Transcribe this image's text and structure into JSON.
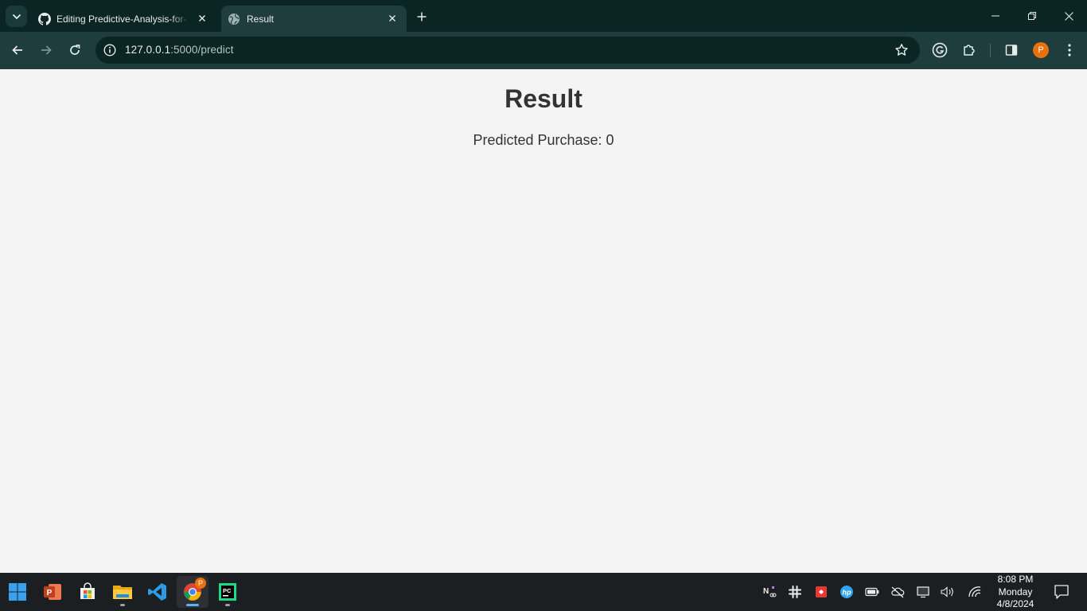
{
  "browser": {
    "tabs": [
      {
        "title": "Editing Predictive-Analysis-for-",
        "favicon": "github-icon"
      },
      {
        "title": "Result",
        "favicon": "globe-icon",
        "active": true
      }
    ],
    "address": {
      "host": "127.0.0.1",
      "path": ":5000/predict"
    },
    "profile_initial": "P",
    "accent_color": "#1e3d3c"
  },
  "page": {
    "title": "Result",
    "prediction_text": "Predicted Purchase: 0"
  },
  "taskbar": {
    "apps": [
      "start-button",
      "powerpoint-icon",
      "store-icon",
      "file-explorer-icon",
      "vscode-icon",
      "chrome-icon",
      "pycharm-icon"
    ],
    "chrome_badge": "P",
    "clock": {
      "time": "8:08 PM",
      "day": "Monday",
      "date": "4/8/2024"
    }
  }
}
